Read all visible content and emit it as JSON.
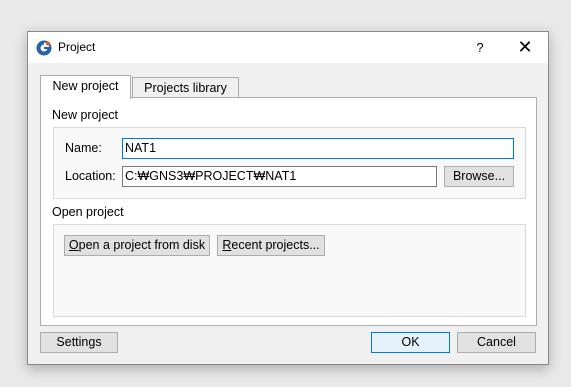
{
  "window": {
    "title": "Project",
    "help_label": "?",
    "close_label": "✕"
  },
  "tabs": [
    {
      "label": "New project",
      "active": true
    },
    {
      "label": "Projects library",
      "active": false
    }
  ],
  "new_project": {
    "section_title": "New project",
    "name_label": "Name:",
    "name_value": "NAT1",
    "location_label": "Location:",
    "location_value": "C:₩GNS3₩PROJECT₩NAT1",
    "browse_label": "Browse..."
  },
  "open_project": {
    "section_title": "Open project",
    "open_disk_rest": "pen a project from disk",
    "open_disk_mnemonic": "O",
    "recent_mnemonic": "R",
    "recent_rest": "ecent projects..."
  },
  "footer": {
    "settings_label": "Settings",
    "ok_label": "OK",
    "cancel_label": "Cancel"
  },
  "icons": {
    "app": "gns3-app-icon",
    "close": "close-icon"
  },
  "colors": {
    "focus_border": "#0078d7",
    "app_icon_blue": "#1f5fa8"
  }
}
